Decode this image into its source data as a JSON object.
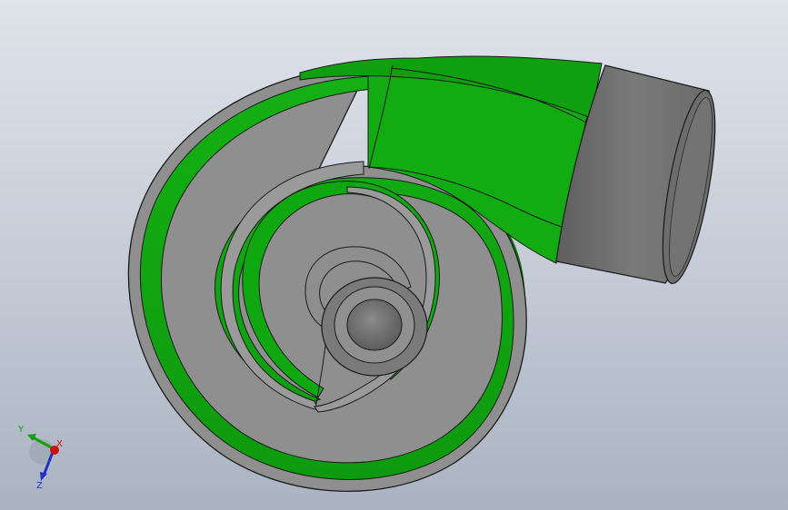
{
  "viewport": {
    "background_top": "#dfe3ea",
    "background_bottom": "#aab3c2"
  },
  "model": {
    "part": "volute-casing",
    "body_color": "#10a010",
    "body_shadow_color": "#078a07",
    "flange_color": "#707070",
    "rim_color": "#8a8a8a",
    "edge_color": "#1a1a1a"
  },
  "triad": {
    "x_label": "X",
    "y_label": "Y",
    "z_label": "Z",
    "x_color": "#d01010",
    "y_color": "#12a012",
    "z_color": "#2030c0"
  }
}
